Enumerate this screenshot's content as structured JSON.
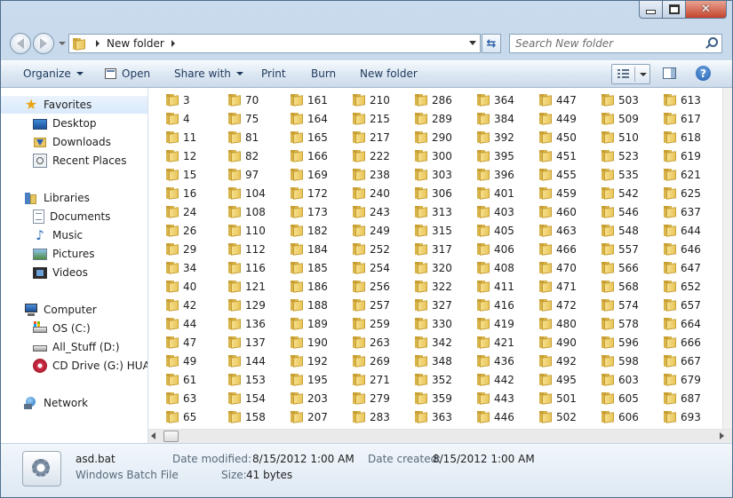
{
  "window": {
    "address": {
      "crumb": "New folder"
    },
    "search": {
      "placeholder": "Search New folder"
    }
  },
  "toolbar": {
    "organize": "Organize",
    "open": "Open",
    "share_with": "Share with",
    "print": "Print",
    "burn": "Burn",
    "new_folder": "New folder",
    "help": "?"
  },
  "nav": {
    "favorites": "Favorites",
    "desktop": "Desktop",
    "downloads": "Downloads",
    "recent_places": "Recent Places",
    "libraries": "Libraries",
    "documents": "Documents",
    "music": "Music",
    "pictures": "Pictures",
    "videos": "Videos",
    "computer": "Computer",
    "os_c": "OS (C:)",
    "all_stuff": "All_Stuff (D:)",
    "cd_drive": "CD Drive (G:) HUAWEI",
    "network": "Network"
  },
  "folders": [
    [
      "3",
      "4",
      "11",
      "12",
      "15",
      "16",
      "24",
      "26",
      "29",
      "34",
      "40",
      "42",
      "44",
      "47",
      "49",
      "61",
      "63",
      "65"
    ],
    [
      "70",
      "75",
      "81",
      "82",
      "97",
      "104",
      "108",
      "110",
      "112",
      "116",
      "121",
      "129",
      "136",
      "137",
      "144",
      "153",
      "154",
      "158"
    ],
    [
      "161",
      "164",
      "165",
      "166",
      "169",
      "172",
      "173",
      "182",
      "184",
      "185",
      "186",
      "188",
      "189",
      "190",
      "192",
      "195",
      "203",
      "207"
    ],
    [
      "210",
      "215",
      "217",
      "222",
      "238",
      "240",
      "243",
      "249",
      "252",
      "254",
      "256",
      "257",
      "259",
      "263",
      "269",
      "271",
      "279",
      "283"
    ],
    [
      "286",
      "289",
      "290",
      "300",
      "303",
      "306",
      "313",
      "315",
      "317",
      "320",
      "322",
      "327",
      "330",
      "342",
      "348",
      "352",
      "359",
      "363"
    ],
    [
      "364",
      "384",
      "392",
      "395",
      "396",
      "401",
      "403",
      "405",
      "406",
      "408",
      "411",
      "416",
      "419",
      "421",
      "436",
      "442",
      "443",
      "446"
    ],
    [
      "447",
      "449",
      "450",
      "451",
      "455",
      "459",
      "460",
      "463",
      "466",
      "470",
      "471",
      "472",
      "480",
      "490",
      "492",
      "495",
      "501",
      "502"
    ],
    [
      "503",
      "509",
      "510",
      "523",
      "535",
      "542",
      "546",
      "548",
      "557",
      "566",
      "568",
      "574",
      "578",
      "596",
      "598",
      "603",
      "605",
      "606"
    ],
    [
      "613",
      "617",
      "618",
      "619",
      "621",
      "625",
      "637",
      "644",
      "646",
      "647",
      "652",
      "657",
      "664",
      "666",
      "667",
      "679",
      "687",
      "693"
    ]
  ],
  "details": {
    "file_name": "asd.bat",
    "file_type": "Windows Batch File",
    "date_modified_label": "Date modified:",
    "date_modified": "8/15/2012 1:00 AM",
    "date_created_label": "Date created:",
    "date_created": "8/15/2012 1:00 AM",
    "size_label": "Size:",
    "size": "41 bytes"
  }
}
